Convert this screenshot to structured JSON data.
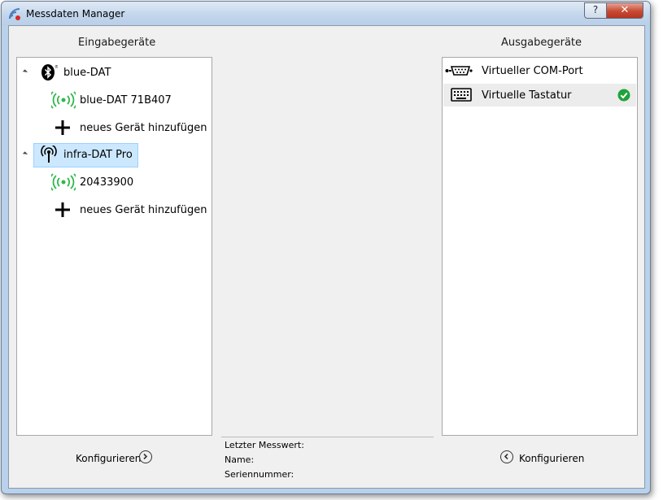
{
  "window": {
    "title": "Messdaten Manager",
    "help_label": "?",
    "close_label": "✕"
  },
  "input_panel": {
    "header": "Eingabegeräte",
    "groups": [
      {
        "label": "blue-DAT",
        "icon": "bluetooth-icon",
        "devices": [
          {
            "label": "blue-DAT 71B407",
            "icon": "wireless-signal-icon"
          }
        ],
        "add_label": "neues Gerät hinzufügen"
      },
      {
        "label": "infra-DAT Pro",
        "icon": "infrared-antenna-icon",
        "selected": true,
        "devices": [
          {
            "label": "20433900",
            "icon": "wireless-signal-icon"
          }
        ],
        "add_label": "neues Gerät hinzufügen"
      }
    ],
    "configure_label": "Konfigurieren"
  },
  "output_panel": {
    "header": "Ausgabegeräte",
    "items": [
      {
        "label": "Virtueller COM-Port",
        "icon": "serial-port-icon",
        "active": false
      },
      {
        "label": "Virtuelle Tastatur",
        "icon": "keyboard-icon",
        "active": true
      }
    ],
    "configure_label": "Konfigurieren"
  },
  "info": {
    "last_value_label": "Letzter Messwert:",
    "name_label": "Name:",
    "serial_label": "Seriennummer:"
  },
  "colors": {
    "accent_green": "#2db84a",
    "selection": "#cce8ff",
    "check_green": "#1fa33a"
  }
}
